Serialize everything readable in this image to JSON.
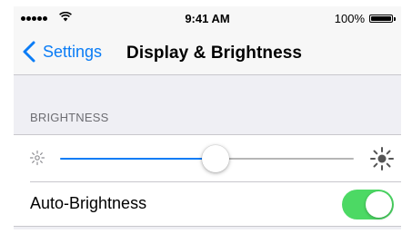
{
  "status_bar": {
    "time": "9:41 AM",
    "battery_percent": "100%",
    "signal_bars": 5,
    "battery_level": 1.0
  },
  "nav": {
    "back_label": "Settings",
    "title": "Display & Brightness"
  },
  "brightness": {
    "section_header": "BRIGHTNESS",
    "slider_value": 0.53,
    "accent_color": "#0a7cf6",
    "low_icon": "sun-small-icon",
    "high_icon": "sun-large-icon"
  },
  "auto_brightness": {
    "label": "Auto-Brightness",
    "enabled": true,
    "on_color": "#4cd964"
  }
}
